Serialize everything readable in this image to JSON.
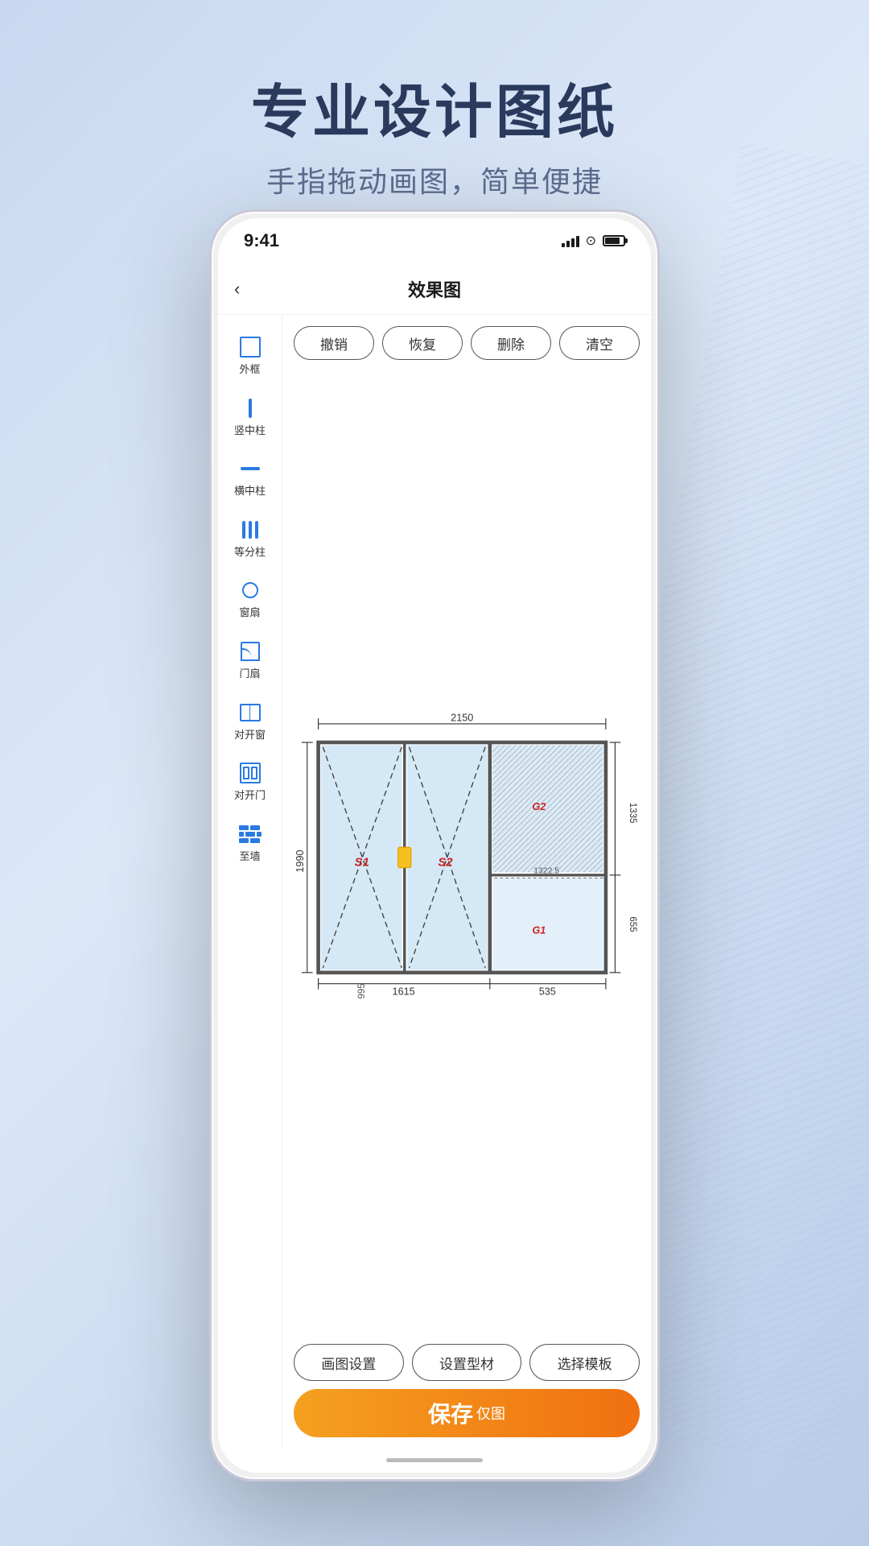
{
  "page": {
    "title": "专业设计图纸",
    "subtitle": "手指拖动画图，简单便捷"
  },
  "status_bar": {
    "time": "9:41"
  },
  "nav": {
    "title": "效果图",
    "back_label": "‹"
  },
  "toolbar": {
    "undo": "撤销",
    "redo": "恢复",
    "delete": "删除",
    "clear": "清空"
  },
  "sidebar": {
    "items": [
      {
        "id": "outer-frame",
        "label": "外框",
        "icon": "outer-frame"
      },
      {
        "id": "vert-pillar",
        "label": "竖中柱",
        "icon": "vert-pillar"
      },
      {
        "id": "horiz-pillar",
        "label": "横中柱",
        "icon": "horiz-pillar"
      },
      {
        "id": "equal-pillars",
        "label": "等分柱",
        "icon": "equal-pillars"
      },
      {
        "id": "window-sash",
        "label": "窗扇",
        "icon": "circle"
      },
      {
        "id": "door-sash",
        "label": "门扇",
        "icon": "door-fan"
      },
      {
        "id": "double-window",
        "label": "对开窗",
        "icon": "double-window"
      },
      {
        "id": "double-door",
        "label": "对开门",
        "icon": "double-door"
      },
      {
        "id": "wall",
        "label": "至墙",
        "icon": "wall"
      }
    ]
  },
  "drawing": {
    "dim_top": "2150",
    "dim_left": "1990",
    "dim_bottom_left": "1615",
    "dim_bottom_right": "535",
    "dim_right_top": "1335",
    "dim_right_mid": "1322.5",
    "dim_right_bottom": "655",
    "dim_center_vert": "995",
    "label_s1": "S1",
    "label_s2": "S2",
    "label_g1": "G1",
    "label_g2": "G2",
    "label_g3": "G1"
  },
  "bottom_toolbar": {
    "draw_settings": "画图设置",
    "set_material": "设置型材",
    "select_template": "选择模板"
  },
  "save_button": {
    "bold_text": "保存",
    "small_text": "仅图"
  }
}
